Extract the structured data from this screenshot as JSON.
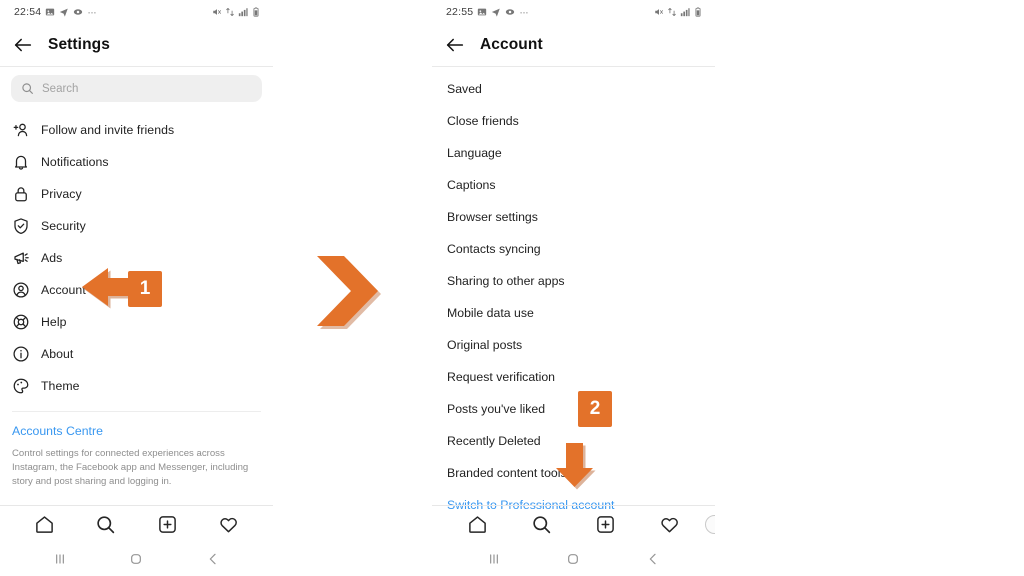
{
  "left_phone": {
    "status_bar": {
      "time": "22:54",
      "left_icons": [
        "image-icon",
        "telegram-send-icon",
        "eye-icon",
        "more-dots-icon"
      ],
      "right_icons": [
        "volume-mute-icon",
        "data-sync-icon",
        "signal-bars-icon",
        "battery-icon"
      ]
    },
    "header": {
      "back_icon": "back-arrow-icon",
      "title": "Settings"
    },
    "search": {
      "icon": "search-icon",
      "placeholder": "Search",
      "value": ""
    },
    "items": [
      {
        "label": "Follow and invite friends",
        "icon": "person-add-icon"
      },
      {
        "label": "Notifications",
        "icon": "bell-icon"
      },
      {
        "label": "Privacy",
        "icon": "lock-icon"
      },
      {
        "label": "Security",
        "icon": "shield-check-icon"
      },
      {
        "label": "Ads",
        "icon": "megaphone-icon"
      },
      {
        "label": "Account",
        "icon": "account-circle-icon"
      },
      {
        "label": "Help",
        "icon": "lifebuoy-icon"
      },
      {
        "label": "About",
        "icon": "info-circle-icon"
      },
      {
        "label": "Theme",
        "icon": "palette-icon"
      }
    ],
    "accounts_centre": {
      "link": "Accounts Centre",
      "description": "Control settings for connected experiences across Instagram, the Facebook app and Messenger, including story and post sharing and logging in."
    },
    "tabbar": [
      "home-icon",
      "search-icon",
      "add-post-icon",
      "heart-icon"
    ],
    "system_nav": [
      "recents-icon",
      "home-circle-icon",
      "back-chevron-icon"
    ]
  },
  "right_phone": {
    "status_bar": {
      "time": "22:55",
      "left_icons": [
        "image-icon",
        "telegram-send-icon",
        "eye-icon",
        "more-dots-icon"
      ],
      "right_icons": [
        "volume-mute-icon",
        "data-sync-icon",
        "signal-bars-icon",
        "battery-icon"
      ]
    },
    "header": {
      "back_icon": "back-arrow-icon",
      "title": "Account"
    },
    "items": [
      {
        "label": "Saved"
      },
      {
        "label": "Close friends"
      },
      {
        "label": "Language"
      },
      {
        "label": "Captions"
      },
      {
        "label": "Browser settings"
      },
      {
        "label": "Contacts syncing"
      },
      {
        "label": "Sharing to other apps"
      },
      {
        "label": "Mobile data use"
      },
      {
        "label": "Original posts"
      },
      {
        "label": "Request verification"
      },
      {
        "label": "Posts you've liked"
      },
      {
        "label": "Recently Deleted"
      },
      {
        "label": "Branded content tools"
      },
      {
        "label": "Switch to Professional account",
        "link": true
      }
    ],
    "tabbar": [
      "home-icon",
      "search-icon",
      "add-post-icon",
      "heart-icon",
      "profile-avatar-icon"
    ],
    "system_nav": [
      "recents-icon",
      "home-circle-icon",
      "back-chevron-icon"
    ]
  },
  "annotations": {
    "accent_color": "#e3722a",
    "step_1": {
      "badge": "1",
      "arrow": "arrow-left",
      "target": "Account"
    },
    "step_2": {
      "badge": "2",
      "arrow": "arrow-down",
      "target": "Switch to Professional account"
    },
    "flow_arrow": "chevron-right"
  }
}
